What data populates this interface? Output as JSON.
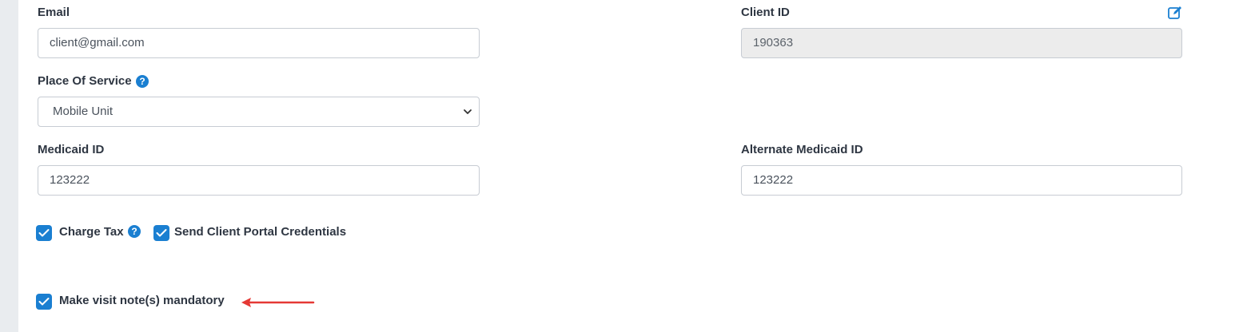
{
  "form": {
    "email": {
      "label": "Email",
      "value": "client@gmail.com"
    },
    "client_id": {
      "label": "Client ID",
      "value": "190363"
    },
    "place_of_service": {
      "label": "Place Of Service",
      "selected": "Mobile Unit"
    },
    "medicaid_id": {
      "label": "Medicaid ID",
      "value": "123222"
    },
    "alternate_medicaid_id": {
      "label": "Alternate Medicaid ID",
      "value": "123222"
    },
    "charge_tax": {
      "label": "Charge Tax",
      "checked": true
    },
    "send_portal_credentials": {
      "label": "Send Client Portal Credentials",
      "checked": true
    },
    "visit_notes_mandatory": {
      "label": "Make visit note(s) mandatory",
      "checked": true
    }
  },
  "icons": {
    "help": "help-circle-icon",
    "edit": "edit-pencil-icon",
    "chevron": "chevron-down-icon",
    "check": "checkmark-icon",
    "annotation": "red-arrow-icon"
  },
  "colors": {
    "accent": "#1a7fd1",
    "arrow": "#e53935",
    "readonly_bg": "#ececec"
  }
}
